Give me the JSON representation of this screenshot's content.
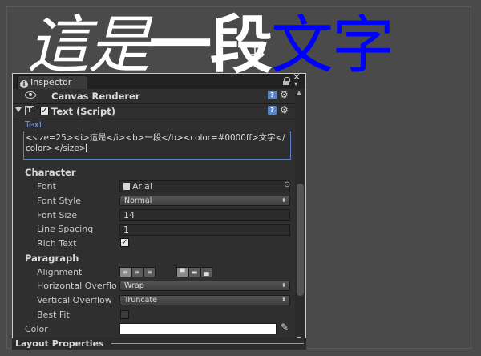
{
  "scene": {
    "text_italic": "這是",
    "text_bold": "一段",
    "text_blue": "文字"
  },
  "inspector": {
    "tab_label": "Inspector",
    "components": {
      "canvas_renderer": "Canvas Renderer",
      "text_script": "Text (Script)"
    },
    "text_field_label": "Text",
    "text_value": "<size=25><i>這是</i><b>一段</b><color=#0000ff>文字</color></size>",
    "character": {
      "section_label": "Character",
      "font_label": "Font",
      "font_value": "Arial",
      "font_style_label": "Font Style",
      "font_style_value": "Normal",
      "font_size_label": "Font Size",
      "font_size_value": "14",
      "line_spacing_label": "Line Spacing",
      "line_spacing_value": "1",
      "rich_text_label": "Rich Text",
      "rich_text_checked": true
    },
    "paragraph": {
      "section_label": "Paragraph",
      "alignment_label": "Alignment",
      "horizontal_overflow_label": "Horizontal Overflo",
      "horizontal_overflow_value": "Wrap",
      "vertical_overflow_label": "Vertical Overflow",
      "vertical_overflow_value": "Truncate",
      "best_fit_label": "Best Fit",
      "best_fit_checked": false
    },
    "color_label": "Color",
    "color_value": "#ffffff",
    "layout_properties_label": "Layout Properties"
  }
}
